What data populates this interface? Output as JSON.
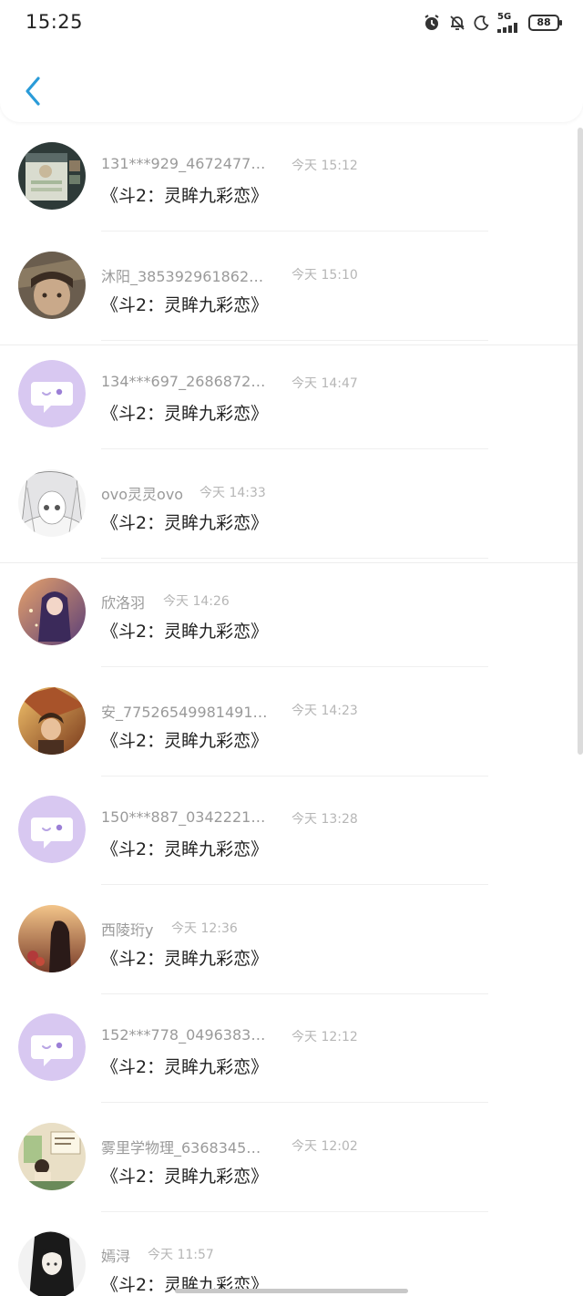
{
  "status_bar": {
    "time": "15:25",
    "network": "5G",
    "battery": "88",
    "icons": [
      "alarm-icon",
      "mute-bell-icon",
      "moon-icon",
      "signal-icon",
      "battery-icon"
    ]
  },
  "header": {
    "back_icon": "chevron-left-icon",
    "accent_color": "#2a9bd8"
  },
  "messages": [
    {
      "name": "131***929_4672477…",
      "time": "今天 15:12",
      "text": "《斗2：灵眸九彩恋》",
      "avatar": "game-screenshot"
    },
    {
      "name": "沐阳_385392961862…",
      "time": "今天 15:10",
      "text": "《斗2：灵眸九彩恋》",
      "avatar": "anime-boy-hat"
    },
    {
      "name": "134***697_2686872…",
      "time": "今天 14:47",
      "text": "《斗2：灵眸九彩恋》",
      "avatar": "default-chat-bubble"
    },
    {
      "name": "ovo灵灵ovo",
      "time": "今天 14:33",
      "text": "《斗2：灵眸九彩恋》",
      "avatar": "anime-sketch-girl"
    },
    {
      "name": "欣洛羽",
      "time": "今天 14:26",
      "text": "《斗2：灵眸九彩恋》",
      "avatar": "anime-girl-purple"
    },
    {
      "name": "安_77526549981491…",
      "time": "今天 14:23",
      "text": "《斗2：灵眸九彩恋》",
      "avatar": "anime-warrior-orange"
    },
    {
      "name": "150***887_0342221…",
      "time": "今天 13:28",
      "text": "《斗2：灵眸九彩恋》",
      "avatar": "default-chat-bubble"
    },
    {
      "name": "西陵珩y",
      "time": "今天 12:36",
      "text": "《斗2：灵眸九彩恋》",
      "avatar": "sunset-girl"
    },
    {
      "name": "152***778_0496383…",
      "time": "今天 12:12",
      "text": "《斗2：灵眸九彩恋》",
      "avatar": "default-chat-bubble"
    },
    {
      "name": "雾里学物理_6368345…",
      "time": "今天 12:02",
      "text": "《斗2：灵眸九彩恋》",
      "avatar": "classroom-illustration"
    },
    {
      "name": "嫣浔",
      "time": "今天 11:57",
      "text": "《斗2：灵眸九彩恋》",
      "avatar": "dark-hair-girl"
    }
  ]
}
